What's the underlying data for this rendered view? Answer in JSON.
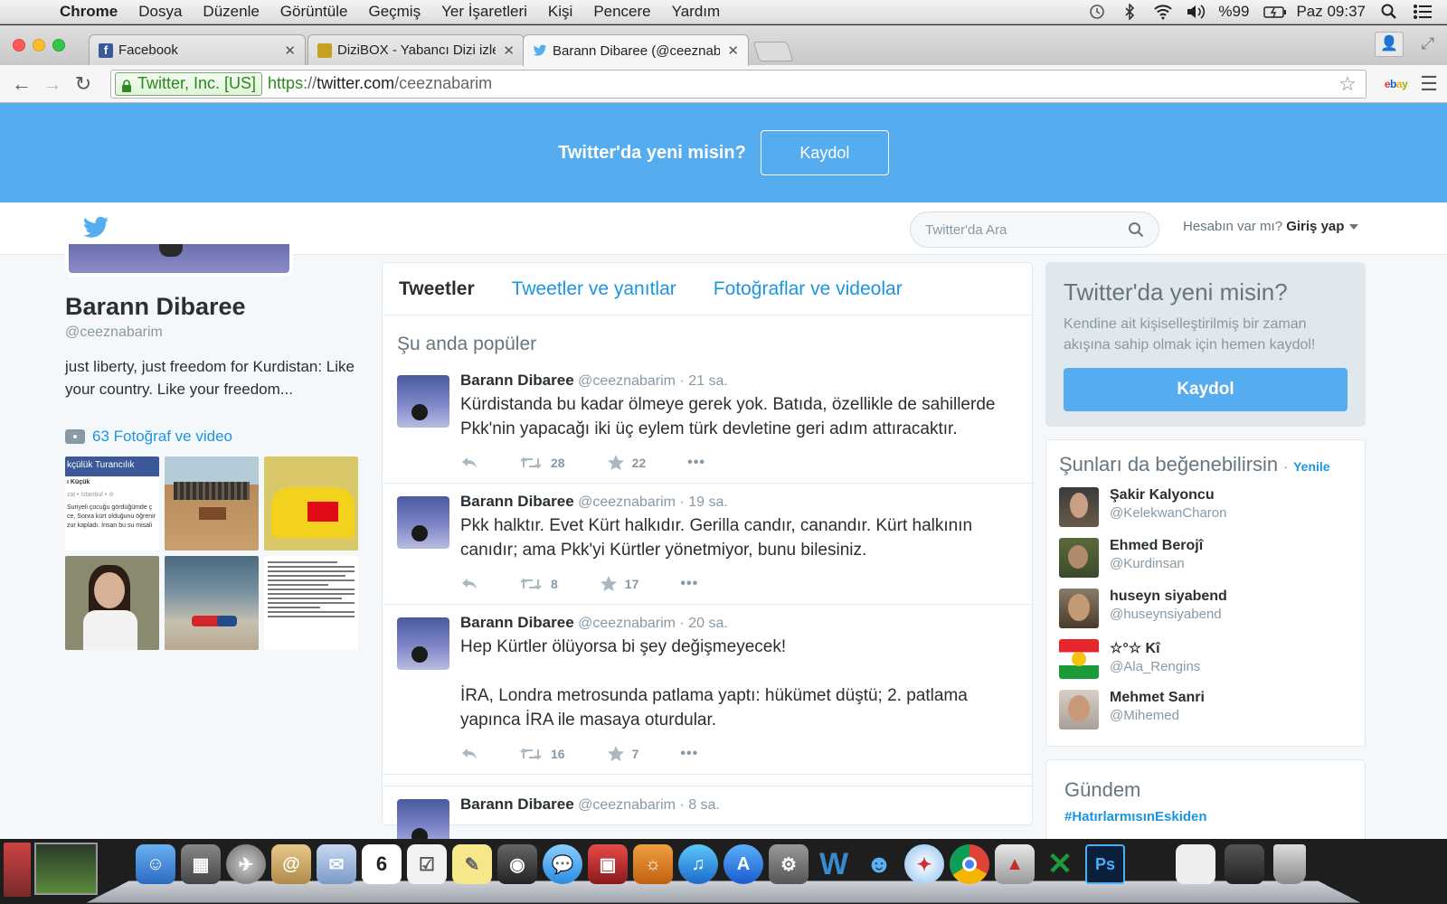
{
  "menubar": {
    "app": "Chrome",
    "items": [
      "Dosya",
      "Düzenle",
      "Görüntüle",
      "Geçmiş",
      "Yer İşaretleri",
      "Kişi",
      "Pencere",
      "Yardım"
    ],
    "battery": "%99",
    "clock": "Paz 09:37"
  },
  "browser": {
    "tabs": [
      {
        "title": "Facebook",
        "icon": "facebook-icon",
        "color": "#3b5998"
      },
      {
        "title": "DiziBOX - Yabancı Dizi izle",
        "icon": "tv-icon",
        "color": "#c8a020"
      },
      {
        "title": "Barann Dibaree (@ceeznab",
        "icon": "twitter-icon",
        "color": "#55acee"
      }
    ],
    "active_tab": 2,
    "ev_label": "Twitter, Inc. [US]",
    "url_scheme": "https",
    "url_sep": "://",
    "url_host": "twitter.com",
    "url_path": "/ceeznabarim",
    "ebay": "ebay"
  },
  "twitter": {
    "banner_text": "Twitter'da yeni misin?",
    "banner_button": "Kaydol",
    "search_placeholder": "Twitter'da Ara",
    "login_question": "Hesabın var mı?",
    "login_link": "Giriş yap",
    "profile": {
      "name": "Barann Dibaree",
      "handle": "@ceeznabarim",
      "bio": "just liberty, just freedom for Kurdistan: Like your country. Like your freedom...",
      "media_label": "63 Fotoğraf ve video",
      "thumb1_header": "kçülük Turancılık",
      "thumb1_title": "ı Küçük",
      "thumb1_sub": "zal • İstanbul • ⊘",
      "thumb1_text": "Suriyeli çocuğu gördüğümde ç ce, Sonra kürt olduğunu öğrenir zur kapladı. İnsan bu su misali"
    },
    "tabs": [
      "Tweetler",
      "Tweetler ve yanıtlar",
      "Fotoğraflar ve videolar"
    ],
    "timeline_heading": "Şu anda popüler",
    "tweets": [
      {
        "name": "Barann Dibaree",
        "handle": "@ceeznabarim",
        "time": "· 21 sa.",
        "text": "Kürdistanda bu kadar ölmeye gerek yok. Batıda, özellikle de sahillerde Pkk'nin yapacağı iki üç eylem türk devletine geri adım attıracaktır.",
        "retweets": "28",
        "favorites": "22"
      },
      {
        "name": "Barann Dibaree",
        "handle": "@ceeznabarim",
        "time": "· 19 sa.",
        "text": "Pkk halktır. Evet Kürt halkıdır. Gerilla candır, canandır. Kürt halkının canıdır; ama Pkk'yi Kürtler yönetmiyor, bunu bilesiniz.",
        "retweets": "8",
        "favorites": "17"
      },
      {
        "name": "Barann Dibaree",
        "handle": "@ceeznabarim",
        "time": "· 20 sa.",
        "text": "Hep Kürtler ölüyorsa bi şey değişmeyecek!\n\nİRA, Londra metrosunda patlama yaptı: hükümet düştü; 2. patlama yapınca İRA ile masaya oturdular.",
        "retweets": "16",
        "favorites": "7"
      },
      {
        "name": "Barann Dibaree",
        "handle": "@ceeznabarim",
        "time": "· 8 sa.",
        "text": "",
        "retweets": "",
        "favorites": ""
      }
    ],
    "signup_box": {
      "title": "Twitter'da yeni misin?",
      "desc": "Kendine ait kişiselleştirilmiş bir zaman akışına sahip olmak için hemen kaydol!",
      "button": "Kaydol"
    },
    "who_to_follow": {
      "title": "Şunları da beğenebilirsin",
      "dot": "·",
      "refresh": "Yenile",
      "users": [
        {
          "name": "Şakir Kalyoncu",
          "handle": "@KelekwanCharon"
        },
        {
          "name": "Ehmed Berojî",
          "handle": "@Kurdinsan"
        },
        {
          "name": "huseyn siyabend",
          "handle": "@huseynsiyabend"
        },
        {
          "name": "☆°☆ Kî",
          "handle": "@Ala_Rengins"
        },
        {
          "name": "Mehmet Sanri",
          "handle": "@Mihemed"
        }
      ]
    },
    "trends": {
      "title": "Gündem",
      "items": [
        "#HatırlarmısınEskiden"
      ]
    }
  },
  "dock": {
    "calendar_day": "6",
    "word_letter": "W",
    "ps_label": "Ps"
  }
}
